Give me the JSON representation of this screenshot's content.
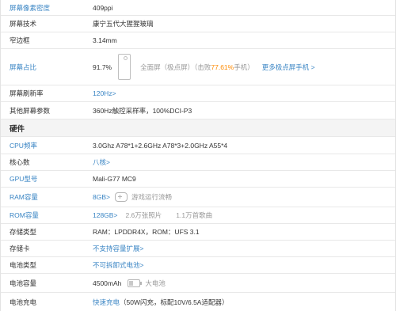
{
  "rows_top": [
    {
      "label": "屏幕像素密度",
      "label_blue": true,
      "value": "409ppi"
    },
    {
      "label": "屏幕技术",
      "label_blue": false,
      "value": "康宁五代大猩猩玻璃"
    },
    {
      "label": "窄边框",
      "label_blue": false,
      "value": "3.14mm"
    }
  ],
  "screen_ratio": {
    "label": "屏幕占比",
    "value": "91.7%",
    "note_prefix": "全面屏（极点屏）（击败",
    "note_percent": "77.61%",
    "note_suffix": "手机）",
    "more_link": "更多极点屏手机 >",
    "icon": "phone-outline-icon"
  },
  "refresh": {
    "label": "屏幕刷新率",
    "value": "120Hz>"
  },
  "other_params": {
    "label": "其他屏幕参数",
    "value": "360Hz触控采样率，100%DCI-P3"
  },
  "section_hardware": "硬件",
  "cpu": {
    "label": "CPU频率",
    "value": "3.0Ghz A78*1+2.6GHz A78*3+2.0GHz A55*4"
  },
  "cores": {
    "label": "核心数",
    "value": "八核>"
  },
  "gpu": {
    "label": "GPU型号",
    "value": "Mali-G77 MC9"
  },
  "ram": {
    "label": "RAM容量",
    "value": "8GB>",
    "note": "游戏运行流畅",
    "icon": "gamepad-icon"
  },
  "rom": {
    "label": "ROM容量",
    "value": "128GB>",
    "note1": "2.6万张照片",
    "note2": "1.1万首歌曲"
  },
  "storage_type": {
    "label": "存储类型",
    "value": "RAM：LPDDR4X，ROM：UFS 3.1"
  },
  "card": {
    "label": "存储卡",
    "value": "不支持容量扩展>"
  },
  "battery_type": {
    "label": "电池类型",
    "value": "不可拆卸式电池>"
  },
  "battery_capacity": {
    "label": "电池容量",
    "value": "4500mAh",
    "note": "大电池",
    "icon": "battery-icon",
    "level": 0.45
  },
  "charging": {
    "label": "电池充电",
    "value": "快速充电",
    "note": "（50W闪充，标配10V/6.5A适配器）"
  },
  "colors": {
    "accent": "#3a85c4",
    "highlight": "#ff8a00",
    "muted": "#999999"
  }
}
